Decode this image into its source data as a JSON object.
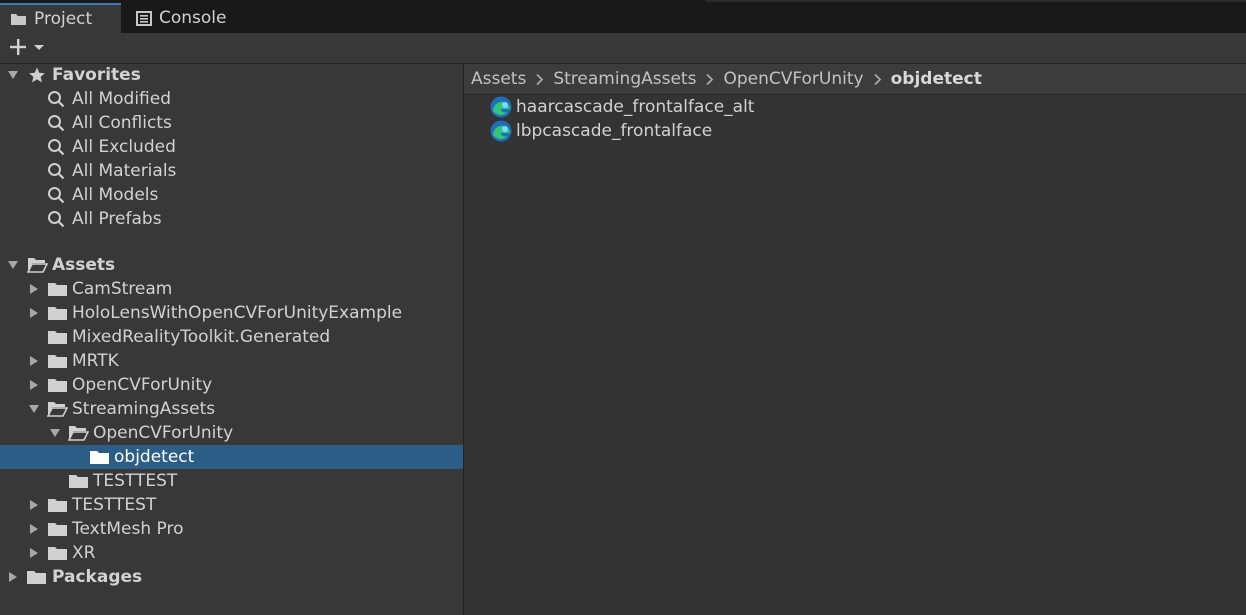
{
  "tabs": [
    {
      "label": "Project",
      "icon": "folder-icon",
      "active": true
    },
    {
      "label": "Console",
      "icon": "console-icon",
      "active": false
    }
  ],
  "toolbar": {
    "add_icon": "plus-icon",
    "dropdown_icon": "chevron-down-icon"
  },
  "favorites": {
    "label": "Favorites",
    "items": [
      "All Modified",
      "All Conflicts",
      "All Excluded",
      "All Materials",
      "All Models",
      "All Prefabs"
    ]
  },
  "assets": {
    "label": "Assets",
    "items": [
      {
        "label": "CamStream",
        "has_children": true,
        "expanded": false
      },
      {
        "label": "HoloLensWithOpenCVForUnityExample",
        "has_children": true,
        "expanded": false
      },
      {
        "label": "MixedRealityToolkit.Generated",
        "has_children": false,
        "expanded": false
      },
      {
        "label": "MRTK",
        "has_children": true,
        "expanded": false
      },
      {
        "label": "OpenCVForUnity",
        "has_children": true,
        "expanded": false
      },
      {
        "label": "StreamingAssets",
        "has_children": true,
        "expanded": true
      },
      {
        "label": "OpenCVForUnity",
        "has_children": true,
        "expanded": true
      },
      {
        "label": "objdetect",
        "has_children": false,
        "selected": true
      },
      {
        "label": "TESTTEST",
        "has_children": false,
        "expanded": false
      },
      {
        "label": "TESTTEST",
        "has_children": true,
        "expanded": false
      },
      {
        "label": "TextMesh Pro",
        "has_children": true,
        "expanded": false
      },
      {
        "label": "XR",
        "has_children": true,
        "expanded": false
      }
    ]
  },
  "packages": {
    "label": "Packages"
  },
  "breadcrumb": [
    "Assets",
    "StreamingAssets",
    "OpenCVForUnity",
    "objdetect"
  ],
  "files": [
    {
      "name": "haarcascade_frontalface_alt",
      "icon": "edge-browser-file-icon"
    },
    {
      "name": "lbpcascade_frontalface",
      "icon": "edge-browser-file-icon"
    }
  ],
  "colors": {
    "selection": "#2c5d87",
    "tab_accent": "#3a79bb",
    "panel": "#383838",
    "content": "#333333"
  }
}
